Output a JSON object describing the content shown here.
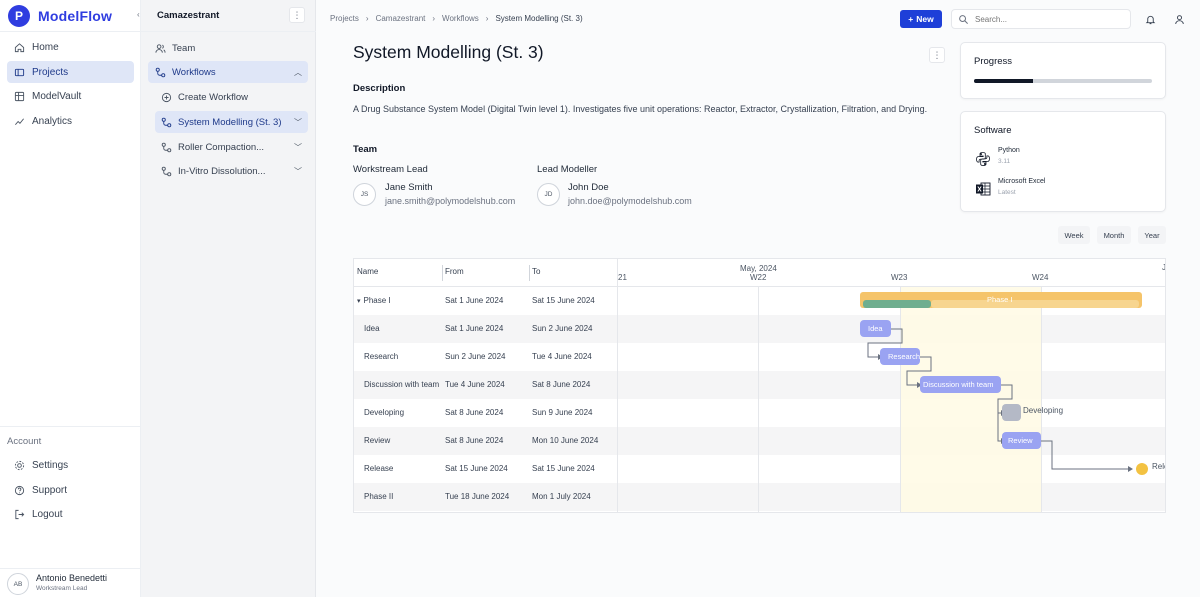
{
  "app": {
    "name": "ModelFlow",
    "logo_letter": "P",
    "accent": "#2f3de0"
  },
  "nav": {
    "items": [
      {
        "label": "Home",
        "icon": "home-icon"
      },
      {
        "label": "Projects",
        "icon": "folder-icon",
        "active": true
      },
      {
        "label": "ModelVault",
        "icon": "vault-icon"
      },
      {
        "label": "Analytics",
        "icon": "chart-icon"
      }
    ],
    "account_label": "Account",
    "account_items": [
      {
        "label": "Settings",
        "icon": "gear-icon"
      },
      {
        "label": "Support",
        "icon": "help-icon"
      },
      {
        "label": "Logout",
        "icon": "logout-icon"
      }
    ],
    "user": {
      "initials": "AB",
      "name": "Antonio Benedetti",
      "role": "Workstream Lead"
    }
  },
  "subnav": {
    "collapse_glyph": "‹",
    "project": "Camazestrant",
    "items": [
      {
        "label": "Team"
      },
      {
        "label": "Workflows",
        "expanded": true
      },
      {
        "label": "Create Workflow"
      },
      {
        "label": "System Modelling (St. 3)",
        "active": true
      },
      {
        "label": "Roller Compaction..."
      },
      {
        "label": "In-Vitro Dissolution..."
      }
    ]
  },
  "header": {
    "breadcrumbs": [
      "Projects",
      "Camazestrant",
      "Workflows",
      "System Modelling (St. 3)"
    ],
    "new_label": "New",
    "search_placeholder": "Search..."
  },
  "main": {
    "title": "System Modelling (St. 3)",
    "description_heading": "Description",
    "description": "A Drug Substance System Model (Digital Twin level 1). Investigates five unit operations: Reactor, Extractor, Crystallization, Filtration, and Drying.",
    "team_heading": "Team",
    "team": [
      {
        "role": "Workstream Lead",
        "initials": "JS",
        "name": "Jane Smith",
        "email": "jane.smith@polymodelshub.com"
      },
      {
        "role": "Lead Modeller",
        "initials": "JD",
        "name": "John Doe",
        "email": "john.doe@polymodelshub.com"
      }
    ]
  },
  "progress": {
    "title": "Progress",
    "value": 0.33
  },
  "software": {
    "title": "Software",
    "items": [
      {
        "name": "Python",
        "version": "3.11",
        "icon": "python-icon"
      },
      {
        "name": "Microsoft Excel",
        "version": "Latest",
        "icon": "excel-icon"
      }
    ]
  },
  "gantt": {
    "views": [
      "Week",
      "Month",
      "Year"
    ],
    "columns": [
      "Name",
      "From",
      "To"
    ],
    "timeline": {
      "month": "May, 2024",
      "weeks": [
        "21",
        "W22",
        "W23",
        "W24",
        "J"
      ]
    },
    "tasks": [
      {
        "name": "Phase I",
        "from": "Sat 1 June 2024",
        "to": "Sat 15 June 2024",
        "group": true
      },
      {
        "name": "Idea",
        "from": "Sat 1 June 2024",
        "to": "Sun 2 June 2024"
      },
      {
        "name": "Research",
        "from": "Sun 2 June 2024",
        "to": "Tue 4 June 2024"
      },
      {
        "name": "Discussion with team",
        "from": "Tue 4 June 2024",
        "to": "Sat 8 June 2024"
      },
      {
        "name": "Developing",
        "from": "Sat 8 June 2024",
        "to": "Sun 9 June 2024"
      },
      {
        "name": "Review",
        "from": "Sat 8 June 2024",
        "to": "Mon 10 June 2024"
      },
      {
        "name": "Release",
        "from": "Sat 15 June 2024",
        "to": "Sat 15 June 2024"
      },
      {
        "name": "Phase II",
        "from": "Tue 18 June 2024",
        "to": "Mon 1 July 2024",
        "group": true
      }
    ],
    "bar_labels": {
      "phase": "Phase I",
      "idea": "Idea",
      "research": "Research",
      "discussion": "Discussion with team",
      "developing": "Developing",
      "review": "Review",
      "release": "Rele"
    },
    "group_toggle": "▾",
    "colors": {
      "phase": "#f5c46a",
      "phase_progress": "#6fae8f",
      "task": "#9aa3f2",
      "task_muted": "#b4b9c6",
      "milestone": "#f3c242",
      "today": "#fffbe6"
    }
  }
}
